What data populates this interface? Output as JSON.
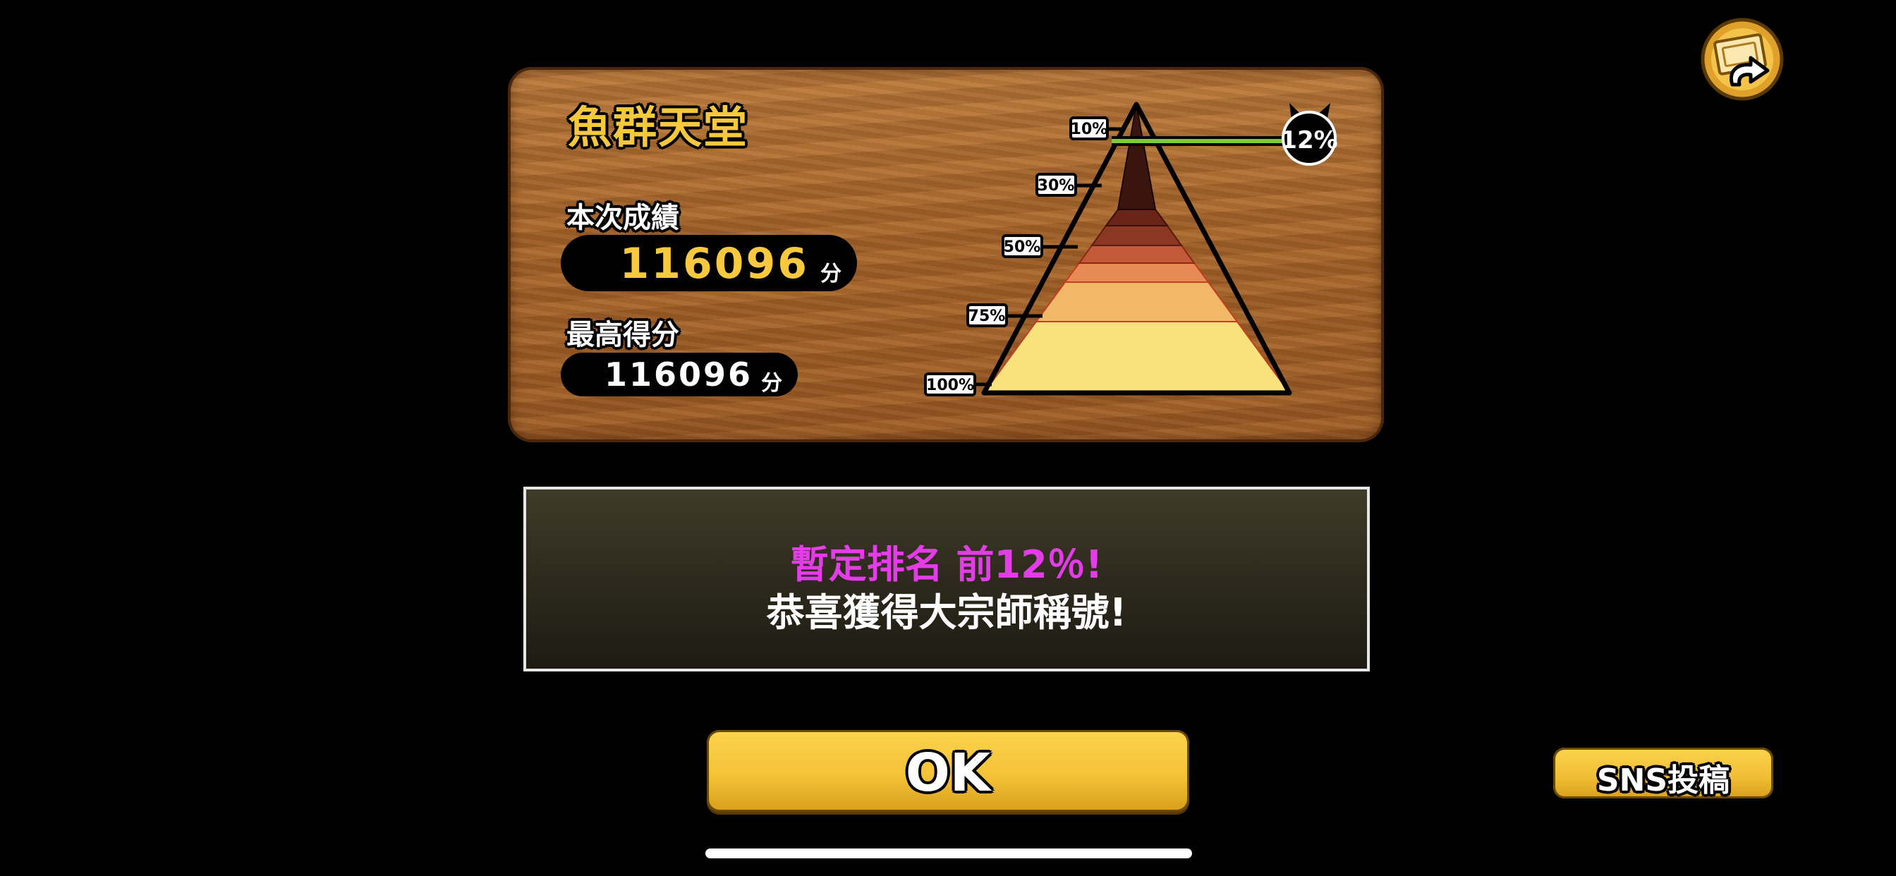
{
  "stage": {
    "title": "魚群天堂"
  },
  "current": {
    "label": "本次成績",
    "score": "116096",
    "unit": "分"
  },
  "best": {
    "label": "最高得分",
    "score": "116096",
    "unit": "分"
  },
  "pyramid": {
    "tiers": [
      "10%",
      "30%",
      "50%",
      "75%",
      "100%"
    ],
    "marker": "12%",
    "colors": [
      "#3a1510",
      "#6a2418",
      "#8c3722",
      "#c4593a",
      "#e78a54",
      "#f0b867",
      "#f7e27b"
    ]
  },
  "message": {
    "rank_line": "暫定排名 前12％!",
    "congrats": "恭喜獲得大宗師稱號!"
  },
  "buttons": {
    "ok": "OK",
    "sns": "SNS投稿"
  },
  "icons": {
    "back": "back-arrow-icon",
    "cat": "cat-head-icon"
  }
}
